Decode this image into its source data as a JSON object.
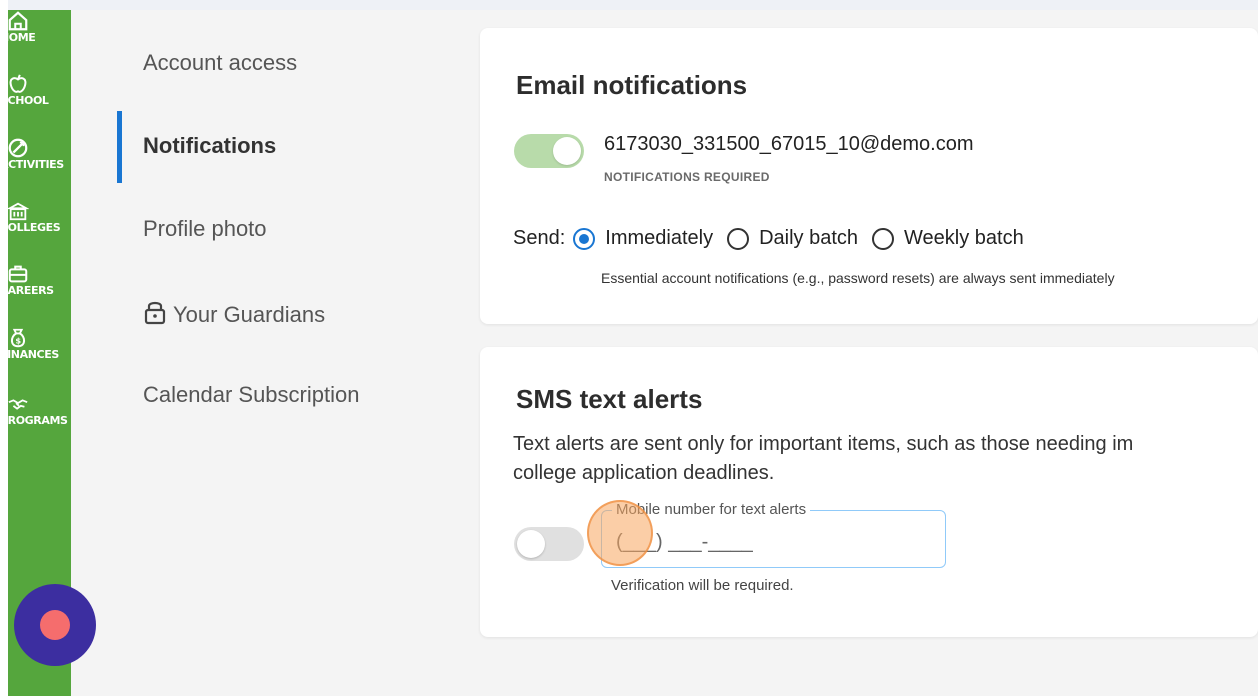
{
  "rail": {
    "items": [
      {
        "label": "HOME",
        "icon": "home-icon"
      },
      {
        "label": "SCHOOL",
        "icon": "apple-icon"
      },
      {
        "label": "ACTIVITIES",
        "icon": "activities-icon"
      },
      {
        "label": "COLLEGES",
        "icon": "college-icon"
      },
      {
        "label": "CAREERS",
        "icon": "briefcase-icon"
      },
      {
        "label": "FINANCES",
        "icon": "money-bag-icon"
      },
      {
        "label": "PROGRAMS",
        "icon": "handshake-icon"
      }
    ]
  },
  "nav": {
    "items": [
      {
        "label": "Account access"
      },
      {
        "label": "Notifications",
        "active": true
      },
      {
        "label": "Profile photo"
      },
      {
        "label": "Your Guardians",
        "icon": "lock-icon"
      },
      {
        "label": "Calendar Subscription"
      }
    ]
  },
  "email": {
    "title": "Email notifications",
    "toggle_on": true,
    "address": "6173030_331500_67015_10@demo.com",
    "required_label": "NOTIFICATIONS REQUIRED",
    "send_label": "Send:",
    "options": [
      "Immediately",
      "Daily batch",
      "Weekly batch"
    ],
    "selected": "Immediately",
    "hint": "Essential account notifications (e.g., password resets) are always sent immediately"
  },
  "sms": {
    "title": "SMS text alerts",
    "description_line1": "Text alerts are sent only for important items, such as those needing im",
    "description_line2": "college application deadlines.",
    "toggle_on": false,
    "field_label": "Mobile number for text alerts",
    "field_value": "(___) ___-____",
    "verification": "Verification will be required."
  },
  "colors": {
    "rail": "#55a63d",
    "accent": "#1976d2",
    "fab": "#3c2ea0",
    "fab_dot": "#f56d6d"
  }
}
